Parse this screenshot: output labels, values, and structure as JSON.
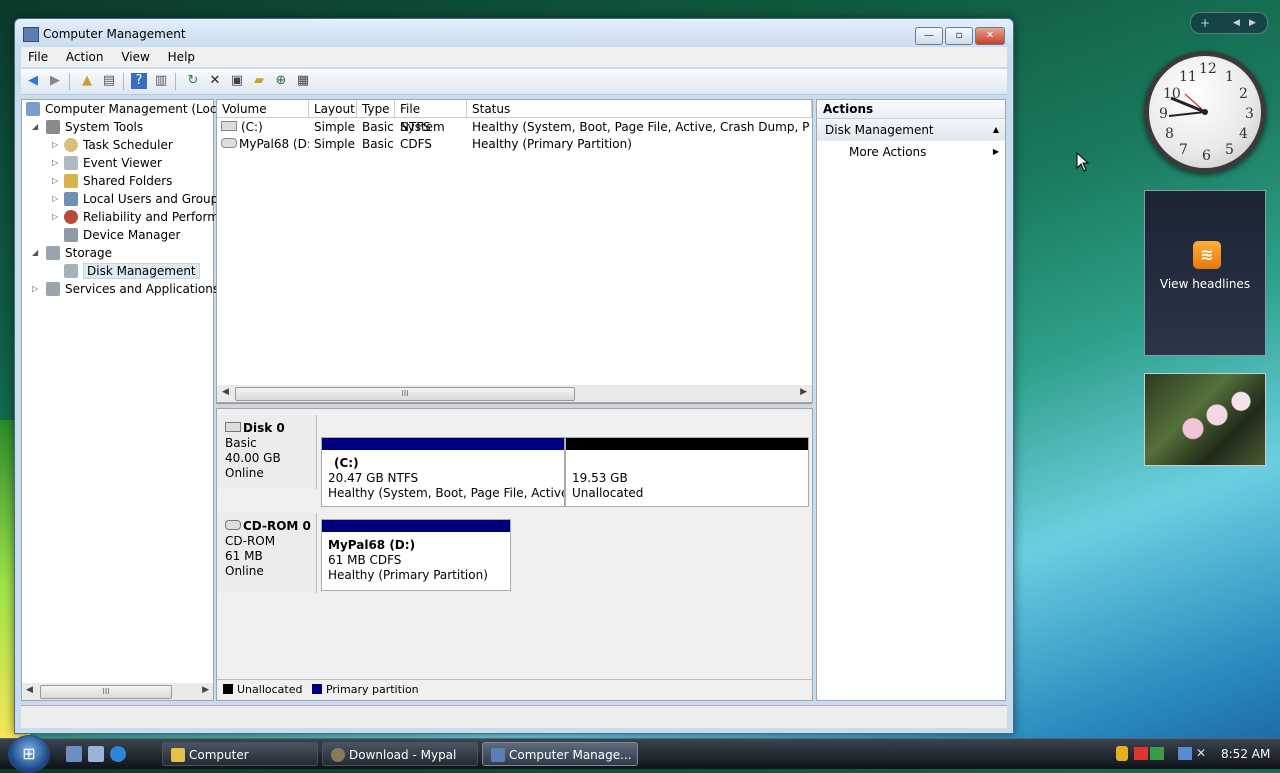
{
  "window": {
    "title": "Computer Management",
    "buttons": {
      "minimize": "—",
      "maximize": "▫",
      "close": "✕"
    }
  },
  "menu": [
    "File",
    "Action",
    "View",
    "Help"
  ],
  "tree": {
    "items": [
      {
        "label": "Computer Management (Local"
      },
      {
        "label": "System Tools"
      },
      {
        "label": "Task Scheduler"
      },
      {
        "label": "Event Viewer"
      },
      {
        "label": "Shared Folders"
      },
      {
        "label": "Local Users and Groups"
      },
      {
        "label": "Reliability and Performa"
      },
      {
        "label": "Device Manager"
      },
      {
        "label": "Storage"
      },
      {
        "label": "Disk Management"
      },
      {
        "label": "Services and Applications"
      }
    ],
    "scroll_thumb": "III"
  },
  "volumes": {
    "columns": [
      "Volume",
      "Layout",
      "Type",
      "File System",
      "Status"
    ],
    "rows": [
      {
        "volume": "(C:)",
        "layout": "Simple",
        "type": "Basic",
        "fs": "NTFS",
        "status": "Healthy (System, Boot, Page File, Active, Crash Dump, Primary P"
      },
      {
        "volume": "MyPal68 (D:)",
        "layout": "Simple",
        "type": "Basic",
        "fs": "CDFS",
        "status": "Healthy (Primary Partition)"
      }
    ],
    "scroll_thumb": "III"
  },
  "disks": [
    {
      "name": "Disk 0",
      "kind": "Basic",
      "size": "40.00 GB",
      "state": "Online",
      "partitions": [
        {
          "label": "(C:)",
          "size": "20.47 GB NTFS",
          "status": "Healthy (System, Boot, Page File, Active, Cr"
        },
        {
          "label": "",
          "size": "19.53 GB",
          "status": "Unallocated"
        }
      ]
    },
    {
      "name": "CD-ROM 0",
      "kind": "CD-ROM",
      "size": "61 MB",
      "state": "Online",
      "partitions": [
        {
          "label": "MyPal68  (D:)",
          "size": "61 MB CDFS",
          "status": "Healthy (Primary Partition)"
        }
      ]
    }
  ],
  "legend": {
    "unallocated": "Unallocated",
    "primary": "Primary partition"
  },
  "actions": {
    "header": "Actions",
    "section": "Disk Management",
    "items": [
      "More Actions"
    ]
  },
  "gadgets": {
    "clock_numbers": [
      "12",
      "1",
      "2",
      "3",
      "4",
      "5",
      "6",
      "7",
      "8",
      "9",
      "10",
      "11"
    ],
    "feed_text": "View headlines"
  },
  "taskbar": {
    "tasks": [
      "Computer",
      "Download - Mypal",
      "Computer Manage..."
    ],
    "time": "8:52 AM"
  },
  "colors": {
    "primary_partition": "#00007f",
    "unallocated": "#000000"
  }
}
